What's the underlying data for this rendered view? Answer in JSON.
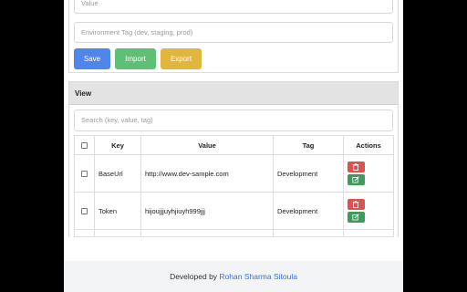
{
  "form": {
    "value_placeholder": "Value",
    "env_placeholder": "Environment Tag (dev, staging, prod)",
    "save_label": "Save",
    "import_label": "Import",
    "export_label": "Export"
  },
  "view": {
    "title": "View",
    "search_placeholder": "Search (key, value, tag)",
    "columns": {
      "key": "Key",
      "value": "Value",
      "tag": "Tag",
      "actions": "Actions"
    },
    "rows": [
      {
        "key": "BaseUrl",
        "value": "http://www.dev-sample.com",
        "tag": "Development"
      },
      {
        "key": "Token",
        "value": "hijoujjjuyhjiuyh999jjj",
        "tag": "Development"
      }
    ]
  },
  "footer": {
    "prefix": "Developed by ",
    "author": "Rohan Sharma Sitoula"
  },
  "colors": {
    "save": "#4f86ec",
    "import": "#5fbf74",
    "export": "#e2b53d",
    "delete": "#d9534f",
    "edit": "#3f9b5c",
    "author_link": "#3a6fd8"
  },
  "icons": {
    "delete": "trash-icon",
    "edit": "edit-icon"
  }
}
